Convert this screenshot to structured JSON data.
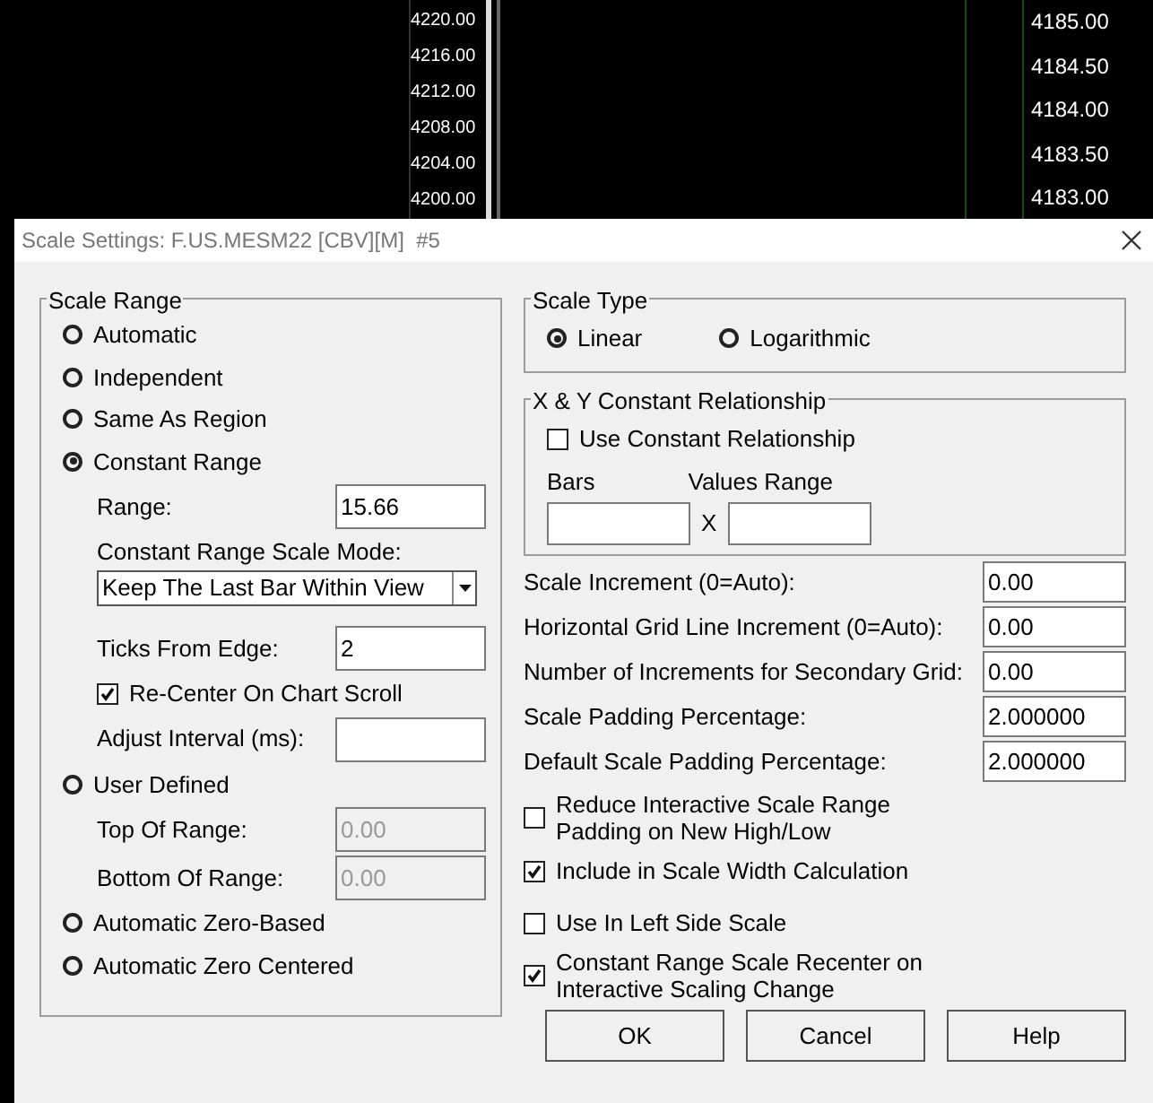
{
  "chart": {
    "left_scale": [
      "4220.00",
      "4216.00",
      "4212.00",
      "4208.00",
      "4204.00",
      "4200.00"
    ],
    "right_scale": [
      "4185.00",
      "4184.50",
      "4184.00",
      "4183.50",
      "4183.00"
    ]
  },
  "dialog": {
    "title": "Scale Settings: F.US.MESM22 [CBV][M]  #5",
    "scale_range": {
      "title": "Scale Range",
      "items": [
        {
          "kind": "radio",
          "label": "Automatic",
          "selected": false
        },
        {
          "kind": "radio",
          "label": "Independent",
          "selected": false
        },
        {
          "kind": "radio",
          "label": "Same As Region",
          "selected": false
        },
        {
          "kind": "radio",
          "label": "Constant Range",
          "selected": true
        },
        {
          "kind": "field",
          "label": "Range:",
          "value": "15.66",
          "disabled": false
        },
        {
          "kind": "select",
          "label": "Constant Range Scale Mode:",
          "value": "Keep The Last Bar Within View"
        },
        {
          "kind": "field",
          "label": "Ticks From Edge:",
          "value": "2",
          "disabled": false
        },
        {
          "kind": "check",
          "label": "Re-Center On Chart Scroll",
          "checked": true
        },
        {
          "kind": "field",
          "label": "Adjust Interval (ms):",
          "disabled": false
        },
        {
          "kind": "radio",
          "label": "User Defined",
          "selected": false
        },
        {
          "kind": "field",
          "label": "Top Of Range:",
          "value": "0.00",
          "disabled": true
        },
        {
          "kind": "field",
          "label": "Bottom Of Range:",
          "value": "0.00",
          "disabled": true
        },
        {
          "kind": "radio",
          "label": "Automatic Zero-Based",
          "selected": false
        },
        {
          "kind": "radio",
          "label": "Automatic Zero Centered",
          "selected": false
        }
      ]
    },
    "scale_type": {
      "title": "Scale Type",
      "options": [
        {
          "label": "Linear",
          "selected": true
        },
        {
          "label": "Logarithmic",
          "selected": false
        }
      ]
    },
    "xy_relationship": {
      "title": "X & Y Constant Relationship",
      "use": {
        "label": "Use Constant Relationship",
        "checked": false
      },
      "bars_label": "Bars",
      "times": "X",
      "values_label": "Values Range"
    },
    "fields": [
      {
        "label": "Scale Increment (0=Auto):",
        "value": "0.00"
      },
      {
        "label": "Horizontal Grid Line Increment (0=Auto):",
        "value": "0.00"
      },
      {
        "label": "Number of Increments for Secondary Grid:",
        "value": "0.00"
      },
      {
        "label": "Scale Padding Percentage:",
        "value": "2.000000"
      },
      {
        "label": "Default Scale Padding Percentage:",
        "value": "2.000000"
      }
    ],
    "checks": [
      {
        "label": "Reduce Interactive Scale Range Padding on New High/Low",
        "checked": false
      },
      {
        "label": "Include in Scale Width Calculation",
        "checked": true
      },
      {
        "label": "Use In Left Side Scale",
        "checked": false
      },
      {
        "label": "Constant Range Scale Recenter on Interactive Scaling Change",
        "checked": true
      }
    ],
    "buttons": [
      "OK",
      "Cancel",
      "Help"
    ]
  }
}
